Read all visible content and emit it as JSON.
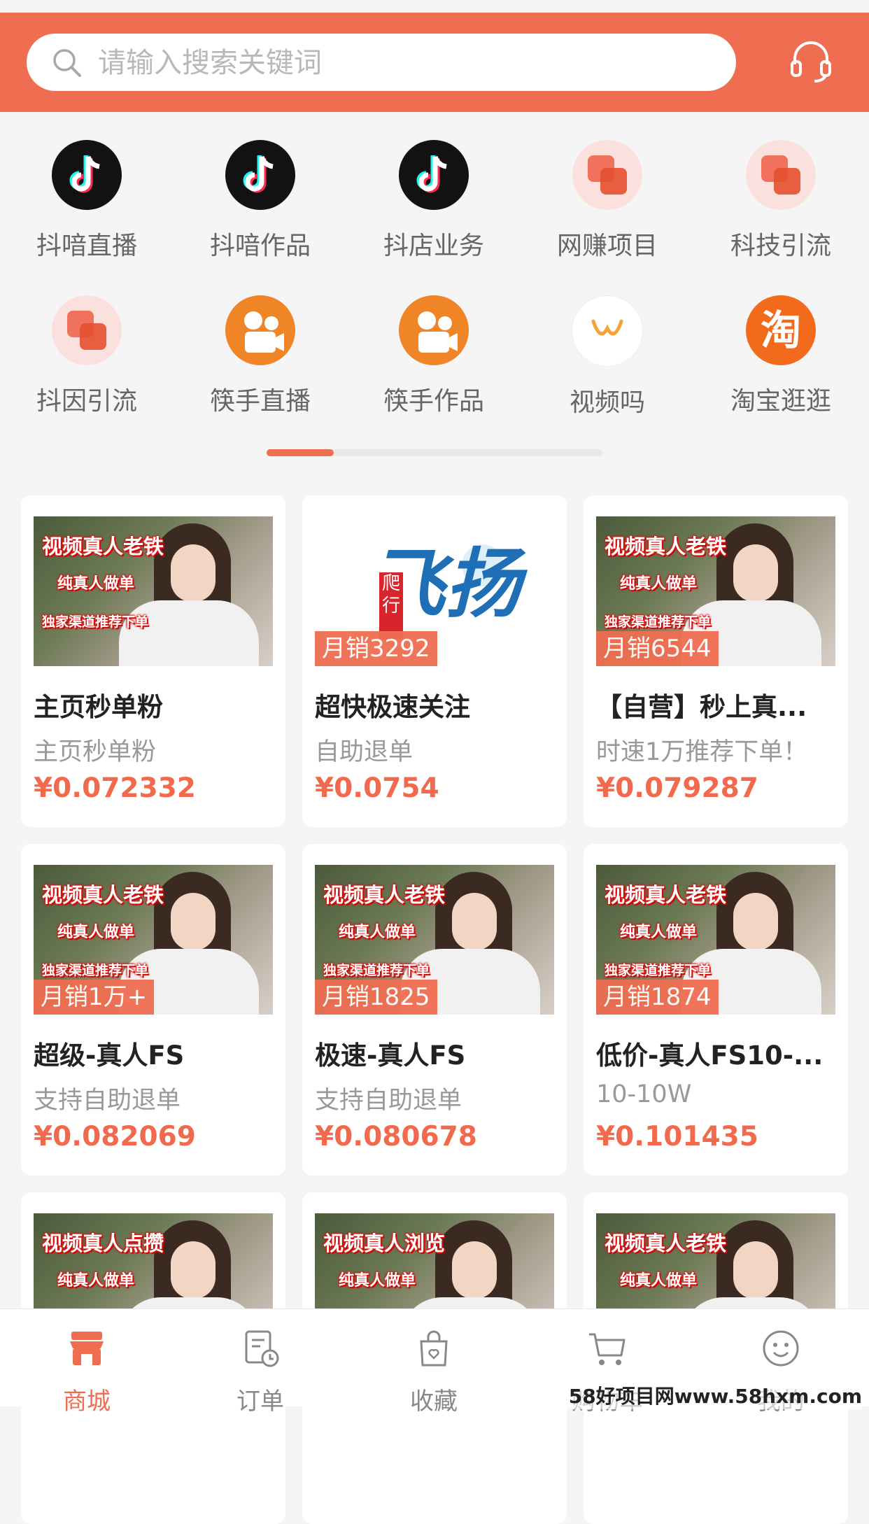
{
  "search": {
    "placeholder": "请输入搜索关键词"
  },
  "icons": {
    "search": "search-icon",
    "support": "headset-icon"
  },
  "categories": [
    {
      "label": "抖喑直播",
      "icon": "tiktok-icon"
    },
    {
      "label": "抖喑作品",
      "icon": "tiktok-icon"
    },
    {
      "label": "抖店业务",
      "icon": "tiktok-icon"
    },
    {
      "label": "网赚项目",
      "icon": "stacked-squares-icon"
    },
    {
      "label": "科技引流",
      "icon": "stacked-squares-icon"
    },
    {
      "label": "抖因引流",
      "icon": "stacked-squares-icon"
    },
    {
      "label": "筷手直播",
      "icon": "kuaishou-icon"
    },
    {
      "label": "筷手作品",
      "icon": "kuaishou-icon"
    },
    {
      "label": "视频吗",
      "icon": "wechat-channels-icon"
    },
    {
      "label": "淘宝逛逛",
      "icon": "taobao-icon",
      "glyph": "淘"
    }
  ],
  "banner_text": {
    "real_person": "视频真人老铁",
    "real_person_like": "视频真人点攒",
    "real_person_view": "视频真人浏览",
    "real_order": "纯真人做单",
    "exclusive": "独家渠道推荐下单",
    "logo_main": "飞扬",
    "logo_seal": "爬行"
  },
  "products": [
    {
      "title": "主页秒单粉",
      "subtitle": "主页秒单粉",
      "price": "¥0.072332",
      "sales": ""
    },
    {
      "title": "超快极速关注",
      "subtitle": "自助退单",
      "price": "¥0.0754",
      "sales": "月销3292"
    },
    {
      "title": "【自营】秒上真...",
      "subtitle": "时速1万推荐下单！",
      "price": "¥0.079287",
      "sales": "月销6544"
    },
    {
      "title": "超级-真人FS",
      "subtitle": "支持自助退单",
      "price": "¥0.082069",
      "sales": "月销1万+"
    },
    {
      "title": "极速-真人FS",
      "subtitle": "支持自助退单",
      "price": "¥0.080678",
      "sales": "月销1825"
    },
    {
      "title": "低价-真人FS10-...",
      "subtitle": "10-10W",
      "price": "¥0.101435",
      "sales": "月销1874"
    }
  ],
  "tabs": [
    {
      "label": "商城",
      "icon": "store-icon",
      "active": true
    },
    {
      "label": "订单",
      "icon": "order-icon",
      "active": false
    },
    {
      "label": "收藏",
      "icon": "favorite-bag-icon",
      "active": false
    },
    {
      "label": "购物车",
      "icon": "cart-icon",
      "active": false
    },
    {
      "label": "我的",
      "icon": "smile-icon",
      "active": false
    }
  ],
  "watermark": "58好项目网www.58hxm.com",
  "colors": {
    "accent": "#ef6e52",
    "price": "#f26a4d",
    "background": "#f5f5f5"
  },
  "pager": {
    "active_page": 1,
    "total_pages": 5
  }
}
